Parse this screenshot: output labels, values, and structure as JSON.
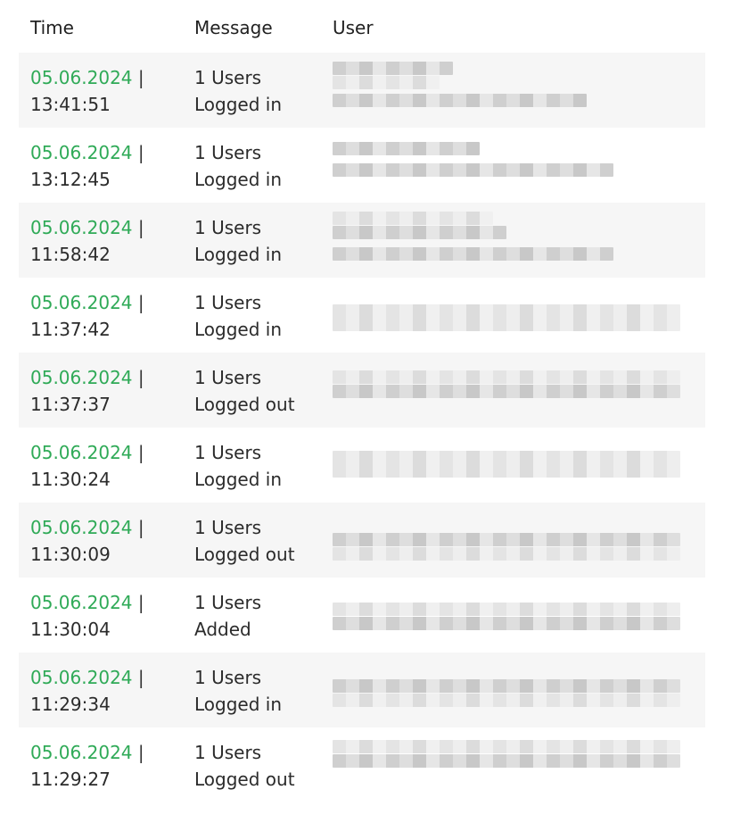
{
  "table": {
    "columns": {
      "time": "Time",
      "message": "Message",
      "user": "User"
    },
    "rows": [
      {
        "date": "05.06.2024",
        "separator": "|",
        "clock": "13:41:51",
        "msg_line1": "1 Users",
        "msg_line2": "Logged in"
      },
      {
        "date": "05.06.2024",
        "separator": "|",
        "clock": "13:12:45",
        "msg_line1": "1 Users",
        "msg_line2": "Logged in"
      },
      {
        "date": "05.06.2024",
        "separator": "|",
        "clock": "11:58:42",
        "msg_line1": "1 Users",
        "msg_line2": "Logged in"
      },
      {
        "date": "05.06.2024",
        "separator": "|",
        "clock": "11:37:42",
        "msg_line1": "1 Users",
        "msg_line2": "Logged in"
      },
      {
        "date": "05.06.2024",
        "separator": "|",
        "clock": "11:37:37",
        "msg_line1": "1 Users",
        "msg_line2": "Logged out"
      },
      {
        "date": "05.06.2024",
        "separator": "|",
        "clock": "11:30:24",
        "msg_line1": "1 Users",
        "msg_line2": "Logged in"
      },
      {
        "date": "05.06.2024",
        "separator": "|",
        "clock": "11:30:09",
        "msg_line1": "1 Users",
        "msg_line2": "Logged out"
      },
      {
        "date": "05.06.2024",
        "separator": "|",
        "clock": "11:30:04",
        "msg_line1": "1 Users",
        "msg_line2": "Added"
      },
      {
        "date": "05.06.2024",
        "separator": "|",
        "clock": "11:29:34",
        "msg_line1": "1 Users",
        "msg_line2": "Logged in"
      },
      {
        "date": "05.06.2024",
        "separator": "|",
        "clock": "11:29:27",
        "msg_line1": "1 Users",
        "msg_line2": "Logged out"
      }
    ]
  },
  "colors": {
    "date_text": "#2faa57",
    "row_shade": "#f6f6f6",
    "text": "#2b2b2b"
  },
  "user_column_state": "pixelated"
}
